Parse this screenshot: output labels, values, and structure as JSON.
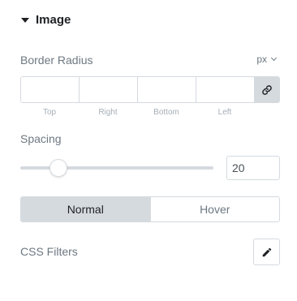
{
  "section": {
    "title": "Image",
    "caret_icon": "caret-down-icon"
  },
  "border_radius": {
    "label": "Border Radius",
    "unit": "px",
    "inputs": [
      {
        "label": "Top",
        "value": ""
      },
      {
        "label": "Right",
        "value": ""
      },
      {
        "label": "Bottom",
        "value": ""
      },
      {
        "label": "Left",
        "value": ""
      }
    ],
    "link_icon": "link-icon"
  },
  "spacing": {
    "label": "Spacing",
    "value": "20",
    "slider_fraction": 0.2
  },
  "tabs": {
    "normal": "Normal",
    "hover": "Hover",
    "active": "Normal"
  },
  "css_filters": {
    "label": "CSS Filters",
    "edit_icon": "pencil-icon"
  },
  "colors": {
    "border": "#d5dadf",
    "label": "#6d7882",
    "title": "#1f2124"
  }
}
